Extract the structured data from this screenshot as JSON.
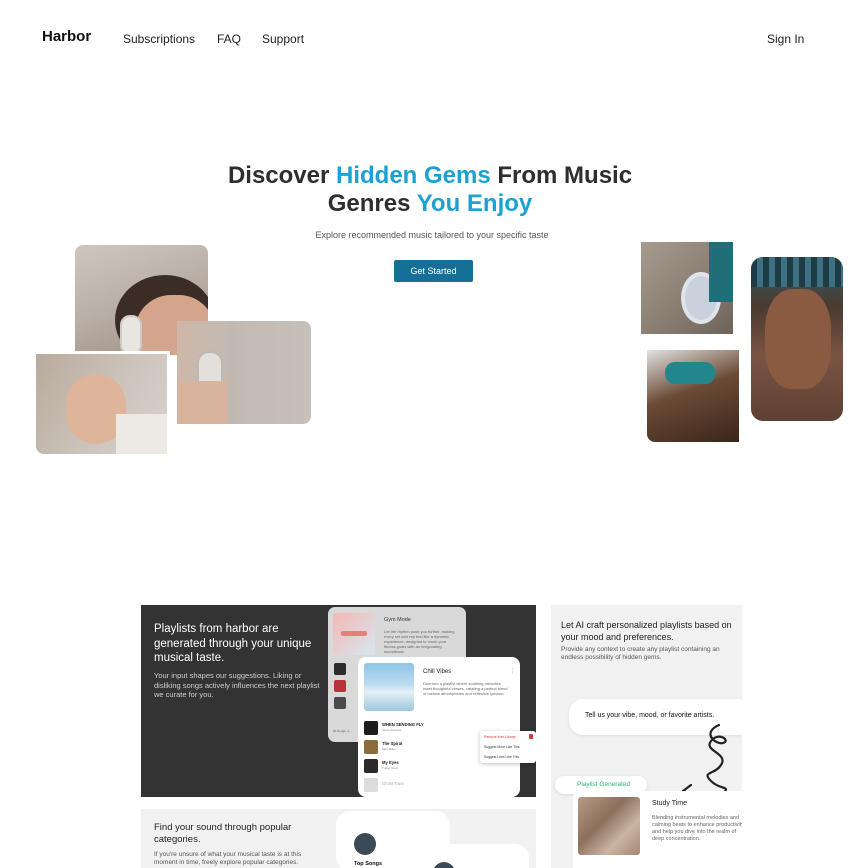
{
  "nav": {
    "brand": "Harbor",
    "links": [
      "Subscriptions",
      "FAQ",
      "Support"
    ],
    "sign_in": "Sign In"
  },
  "hero": {
    "title_part1": "Discover ",
    "title_accent1": "Hidden Gems",
    "title_part2": " From Music",
    "title_part3": "Genres ",
    "title_accent2": "You Enjoy",
    "subtitle": "Explore recommended music tailored to your specific taste",
    "cta": "Get Started"
  },
  "feature1": {
    "title": "Playlists from harbor are generated through your unique musical taste.",
    "body": "Your input shapes our suggestions. Liking or disliking songs actively influences the next playlist we curate for you.",
    "gym_mode": {
      "title": "Gym Mode",
      "desc": "Let the rhythm push you further, making every set and rep feel like a dynamic experience, designed to crush your fitness goals with an invigorating soundtrack.",
      "footer": "20 Songs, 1..."
    },
    "chill_vibes": {
      "title": "Chill Vibes",
      "desc": "Dive into a playlist where soothing melodies meet thoughtful verses, creating a perfect blend of mellow atmospheres and reflective lyricism.",
      "songs": [
        {
          "title": "WHEN SENDING FLY",
          "artist": "Some Kitaysia"
        },
        {
          "title": "The Spiral",
          "artist": "Man Miller"
        },
        {
          "title": "My Eyes",
          "artist": "Travis Scott"
        },
        {
          "title": "Ghost Town",
          "artist": ""
        }
      ],
      "menu": [
        "Remove from Library",
        "Suggest More Like This",
        "Suggest Less Like This"
      ]
    }
  },
  "feature2": {
    "title": "Let AI craft personalized playlists based on your mood and preferences.",
    "body": "Provide any context to create any playlist containing an endless possibility of hidden gems.",
    "prompt": "Tell us your vibe, mood, or favorite artists.",
    "badge": "Playlist Generated",
    "playlist_title": "Study Time",
    "playlist_desc": "Blending instrumental melodies and calming beats to enhance productivity and help you dive into the realm of deep concentration."
  },
  "feature3": {
    "title": "Find your sound through popular categories.",
    "body": "If you're unsure of what your musical taste is at this moment in time, freely explore popular categories.",
    "card_label": "Top Songs"
  },
  "colors": {
    "accent": "#1ba2d2",
    "cta_bg": "#156f96",
    "dark_panel": "#333333",
    "light_panel": "#f1f1f1",
    "badge_green": "#2bb673"
  }
}
